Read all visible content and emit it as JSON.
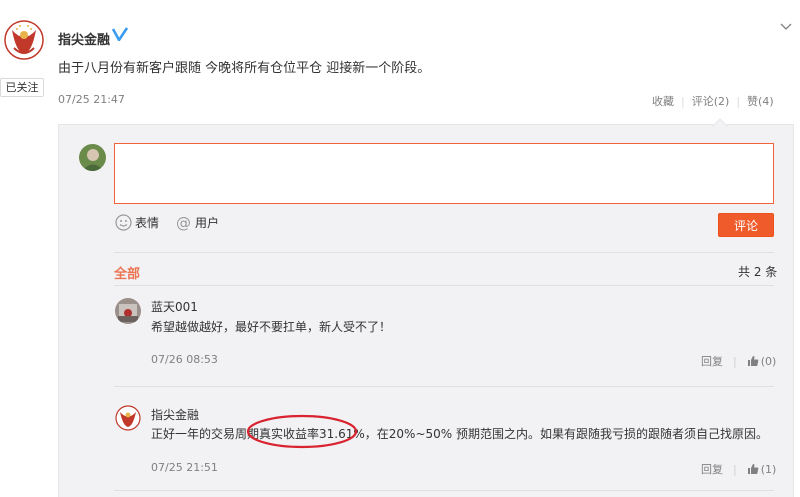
{
  "post": {
    "author": "指尖金融",
    "follow_label": "已关注",
    "text": "由于八月份有新客户跟随 今晚将所有仓位平仓 迎接新一个阶段。",
    "time": "07/25 21:47",
    "actions": {
      "favorite": "收藏",
      "comment": "评论(2)",
      "like": "赞(4)"
    }
  },
  "composer": {
    "emoji_label": "表情",
    "mention_label": "用户",
    "submit_label": "评论"
  },
  "comments_header": {
    "all_label": "全部",
    "count_label": "共 2 条"
  },
  "comments": [
    {
      "author": "蓝天001",
      "text": "希望越做越好，最好不要扛单，新人受不了！",
      "time": "07/26 08:53",
      "reply_label": "回复",
      "like_label": "(0)"
    },
    {
      "author": "指尖金融",
      "text_before": "正好一年的交易周期",
      "text_highlight": "真实收益率31.61%",
      "text_after": "，在20%~50% 预期范围之内。如果有跟随我亏损的跟随者须自己找原因。",
      "time": "07/25 21:51",
      "reply_label": "回复",
      "like_label": "(1)"
    }
  ],
  "colors": {
    "accent": "#eb7350",
    "button": "#f05b2b",
    "panel_bg": "#f2f2f5",
    "verified": "#3b9cf0",
    "highlight_ring": "#d9232e"
  },
  "icons": [
    "brand-logo-icon",
    "verified-icon",
    "chevron-down-icon",
    "emoji-icon",
    "at-icon",
    "like-icon"
  ]
}
